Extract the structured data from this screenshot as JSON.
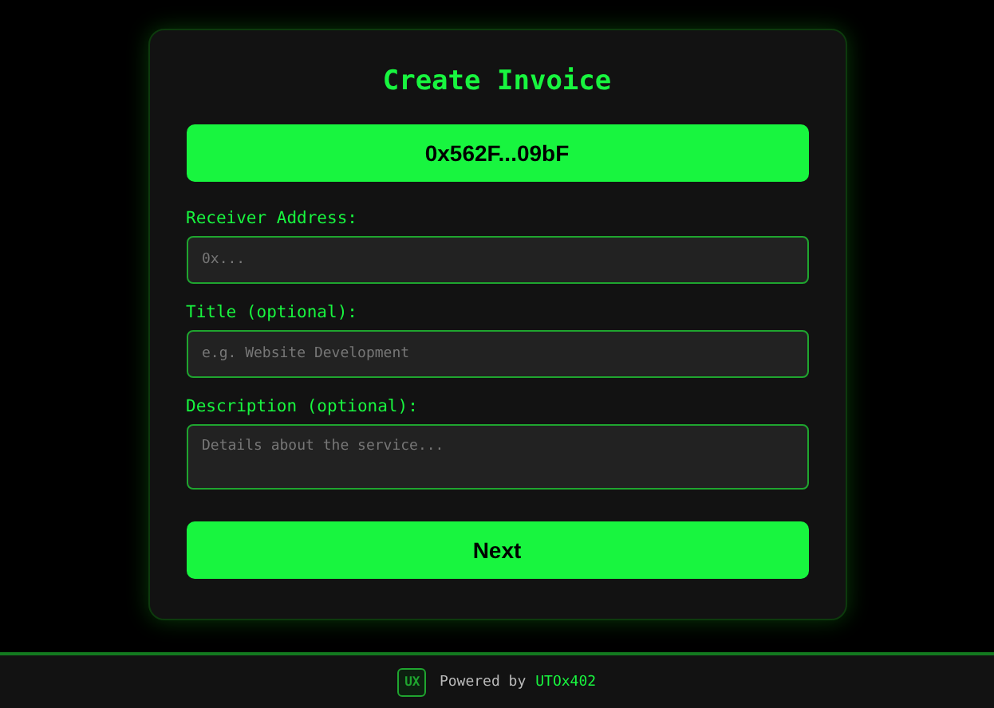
{
  "title": "Create Invoice",
  "wallet_button": "0x562F...09bF",
  "fields": [
    {
      "label": "Receiver Address:",
      "placeholder": "0x...",
      "kind": "input"
    },
    {
      "label": "Title (optional):",
      "placeholder": "e.g. Website Development",
      "kind": "input"
    },
    {
      "label": "Description (optional):",
      "placeholder": "Details about the service...",
      "kind": "textarea"
    }
  ],
  "next_button": "Next",
  "footer": {
    "logo": "UX",
    "text": "Powered by",
    "brand": "UTOx402"
  }
}
